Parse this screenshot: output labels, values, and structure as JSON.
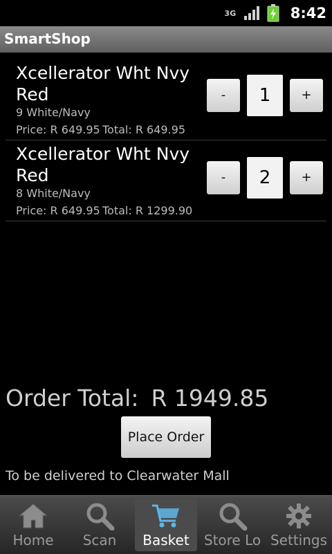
{
  "status_bar": {
    "network": "3G",
    "time": "8:42"
  },
  "app": {
    "title": "SmartShop"
  },
  "basket": {
    "items": [
      {
        "title": "Xcellerator Wht Nvy Red",
        "variant": "9 White/Navy",
        "price": "Price: R 649.95",
        "total": "Total: R 649.95",
        "qty": "1",
        "minus": "-",
        "plus": "+"
      },
      {
        "title": "Xcellerator Wht Nvy Red",
        "variant": "8 White/Navy",
        "price": "Price: R 649.95",
        "total": "Total: R 1299.90",
        "qty": "2",
        "minus": "-",
        "plus": "+"
      }
    ]
  },
  "order": {
    "total_label": "Order Total:",
    "total_value": "R 1949.85",
    "place_order": "Place Order",
    "delivery_note": "To be delivered to Clearwater Mall"
  },
  "tabs": [
    {
      "label": "Home",
      "icon": "home-icon",
      "selected": false
    },
    {
      "label": "Scan",
      "icon": "magnifier-icon",
      "selected": false
    },
    {
      "label": "Basket",
      "icon": "cart-icon",
      "selected": true
    },
    {
      "label": "Store Lo",
      "icon": "store-locator-icon",
      "selected": false
    },
    {
      "label": "Settings",
      "icon": "gear-icon",
      "selected": false
    }
  ],
  "colors": {
    "accent_blue": "#5fb6e8",
    "battery_green": "#6cd12e"
  }
}
